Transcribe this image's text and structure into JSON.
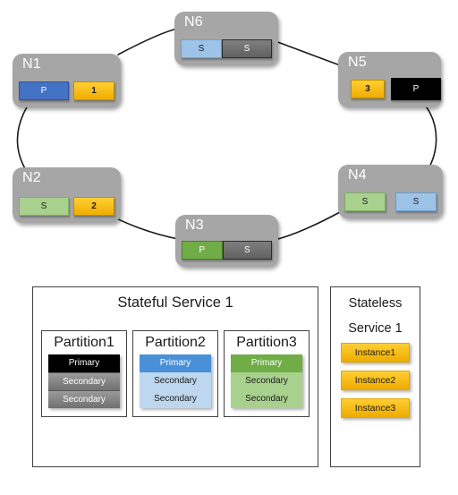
{
  "cluster": {
    "nodes": [
      {
        "id": "n1",
        "title": "N1",
        "chips": [
          {
            "label": "P",
            "style": "blue"
          },
          {
            "label": "1",
            "style": "gold"
          }
        ]
      },
      {
        "id": "n2",
        "title": "N2",
        "chips": [
          {
            "label": "S",
            "style": "lightgreen"
          },
          {
            "label": "2",
            "style": "gold"
          }
        ]
      },
      {
        "id": "n3",
        "title": "N3",
        "chips": [
          {
            "label": "P",
            "style": "green"
          },
          {
            "label": "S",
            "style": "gray"
          }
        ]
      },
      {
        "id": "n4",
        "title": "N4",
        "chips": [
          {
            "label": "S",
            "style": "lightgreen"
          },
          {
            "label": "S",
            "style": "lightblue"
          }
        ]
      },
      {
        "id": "n5",
        "title": "N5",
        "chips": [
          {
            "label": "3",
            "style": "gold"
          },
          {
            "label": "P",
            "style": "black"
          }
        ]
      },
      {
        "id": "n6",
        "title": "N6",
        "chips": [
          {
            "label": "S",
            "style": "lightblue"
          },
          {
            "label": "S",
            "style": "gray"
          }
        ]
      }
    ]
  },
  "stateful_service": {
    "title": "Stateful Service 1",
    "partitions": [
      {
        "title": "Partition1",
        "replicas": [
          "Primary",
          "Secondary",
          "Secondary"
        ]
      },
      {
        "title": "Partition2",
        "replicas": [
          "Primary",
          "Secondary",
          "Secondary"
        ]
      },
      {
        "title": "Partition3",
        "replicas": [
          "Primary",
          "Secondary",
          "Secondary"
        ]
      }
    ]
  },
  "stateless_service": {
    "title_line1": "Stateless",
    "title_line2": "Service 1",
    "instances": [
      "Instance1",
      "Instance2",
      "Instance3"
    ]
  },
  "colors": {
    "node_background": "#a6a6a6",
    "chip_blue": "#4472c4",
    "chip_light_blue": "#9dc3e6",
    "chip_gray": "#7f7f7f",
    "chip_green": "#70ad47",
    "chip_light_green": "#a9d18e",
    "chip_gold": "#ffc000",
    "chip_black": "#000000",
    "panel_border": "#404040",
    "partition2_primary": "#4a90d9",
    "partition2_secondary": "#bdd7ee",
    "partition3_primary": "#70ad47",
    "partition3_secondary": "#a9d18e",
    "instance_fill": "#ffc000",
    "ring_stroke": "#1a1a1a"
  }
}
